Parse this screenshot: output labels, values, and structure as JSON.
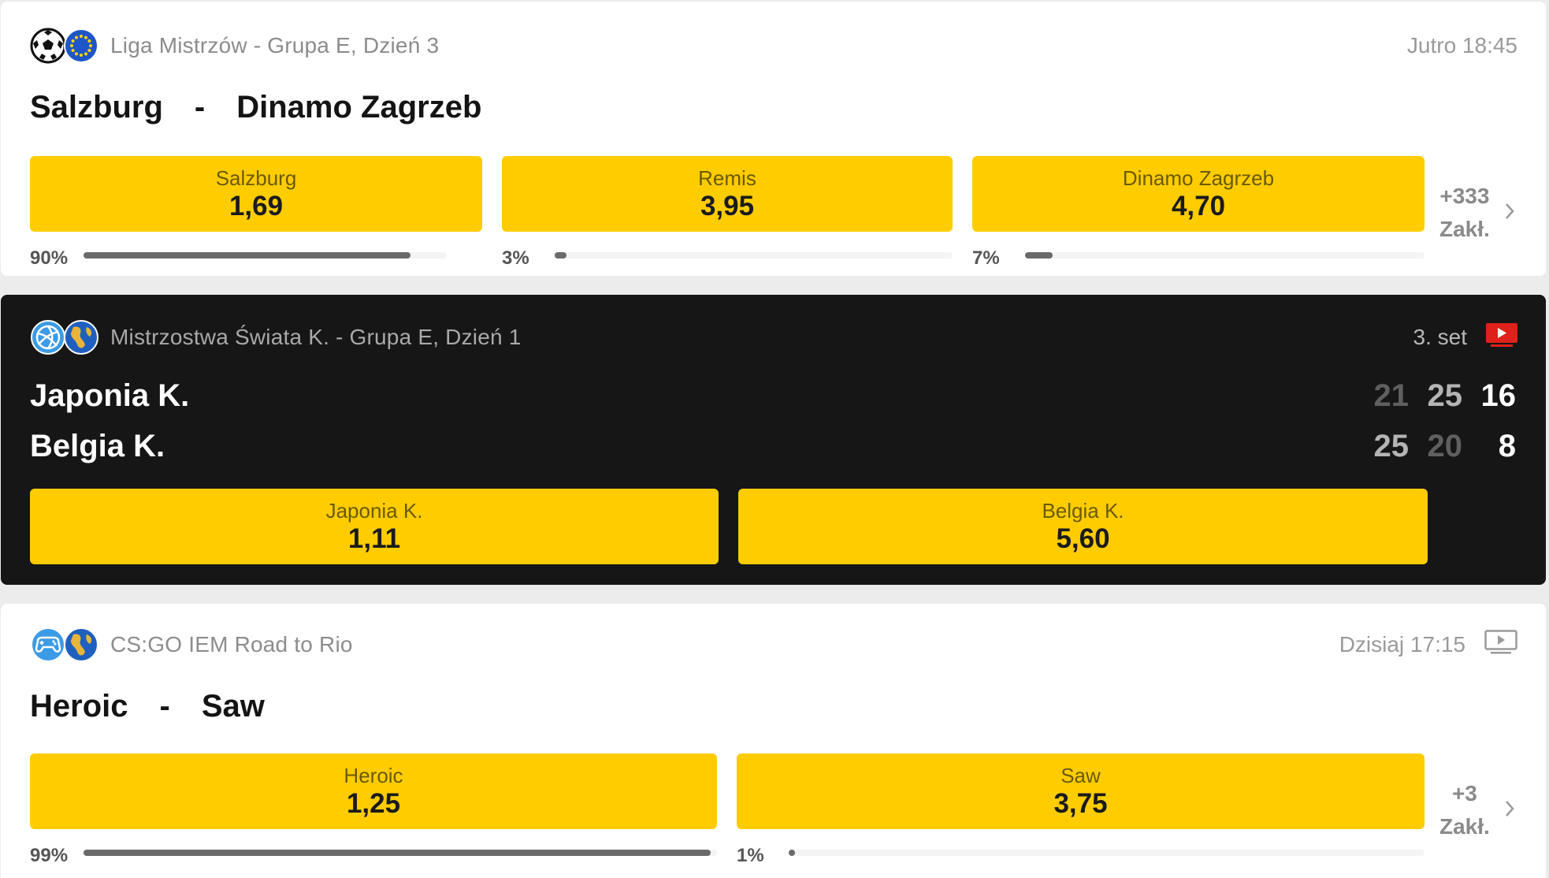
{
  "matches": [
    {
      "league": "Liga Mistrzów - Grupa E, Dzień 3",
      "time": "Jutro 18:45",
      "home": "Salzburg",
      "away": "Dinamo Zagrzeb",
      "sep": "-",
      "odds": [
        {
          "label": "Salzburg",
          "value": "1,69",
          "pct": "90%",
          "share": 0.9
        },
        {
          "label": "Remis",
          "value": "3,95",
          "pct": "3%",
          "share": 0.03
        },
        {
          "label": "Dinamo Zagrzeb",
          "value": "4,70",
          "pct": "7%",
          "share": 0.07
        }
      ],
      "more": {
        "count": "+333",
        "label": "Zakł."
      },
      "icons": [
        "soccer-ball-icon",
        "europe-flag-icon"
      ]
    },
    {
      "league": "Mistrzostwa Świata K. - Grupa E, Dzień 1",
      "status": "3. set",
      "home": "Japonia K.",
      "away": "Belgia K.",
      "home_scores": [
        "21",
        "25",
        "16"
      ],
      "away_scores": [
        "25",
        "20",
        "8"
      ],
      "odds": [
        {
          "label": "Japonia K.",
          "value": "1,11"
        },
        {
          "label": "Belgia K.",
          "value": "5,60"
        }
      ],
      "icons": [
        "volleyball-icon",
        "globe-icon",
        "live-stream-icon"
      ]
    },
    {
      "league": "CS:GO IEM Road to Rio",
      "time": "Dzisiaj 17:15",
      "home": "Heroic",
      "away": "Saw",
      "sep": "-",
      "odds": [
        {
          "label": "Heroic",
          "value": "1,25",
          "pct": "99%",
          "share": 0.99
        },
        {
          "label": "Saw",
          "value": "3,75",
          "pct": "1%",
          "share": 0.01
        }
      ],
      "more": {
        "count": "+3",
        "label": "Zakł."
      },
      "icons": [
        "gamepad-icon",
        "globe-icon",
        "tv-icon"
      ]
    }
  ],
  "colors": {
    "odds_button": "#ffcc00",
    "live_card": "#161616",
    "live_icon": "#e0201b"
  }
}
